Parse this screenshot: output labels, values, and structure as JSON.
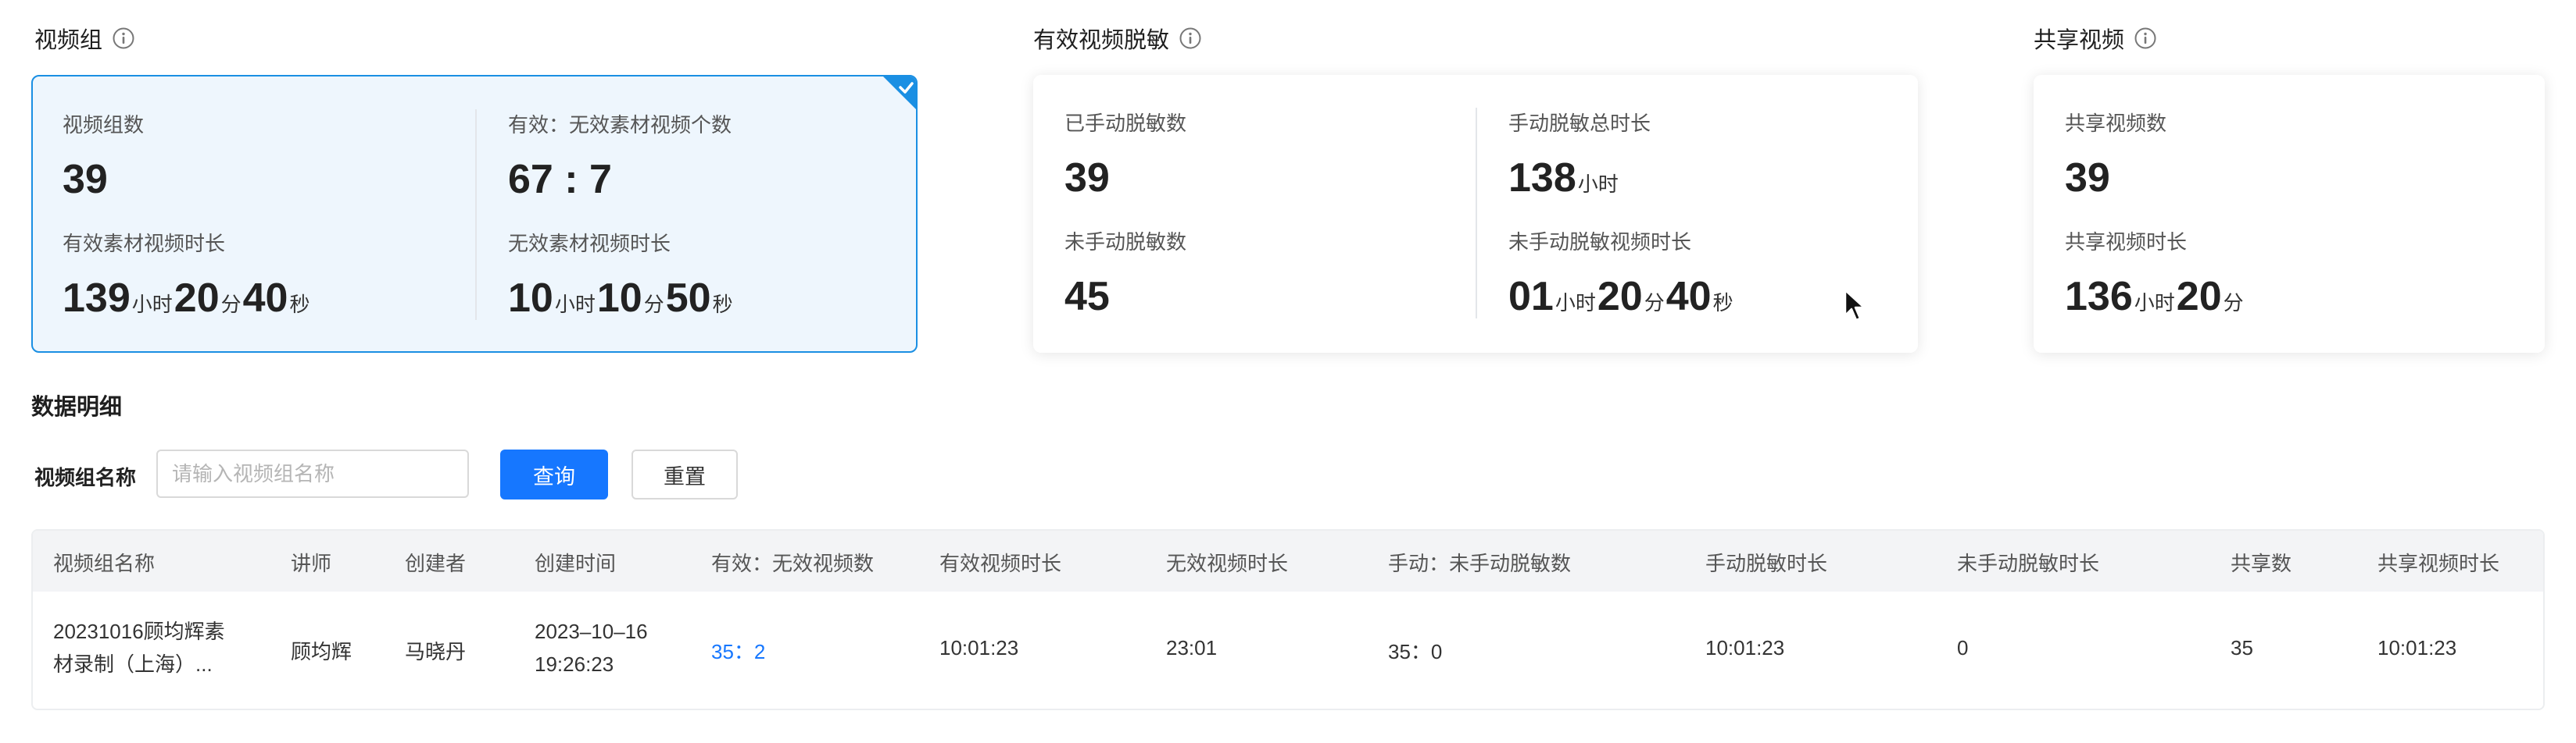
{
  "sections": {
    "video_group": {
      "title": "视频组",
      "metrics": {
        "group_count_label": "视频组数",
        "group_count_value": "39",
        "ratio_label": "有效：无效素材视频个数",
        "ratio_value": "67 : 7",
        "valid_duration_label": "有效素材视频时长",
        "valid_h": "139",
        "valid_m": "20",
        "valid_s": "40",
        "invalid_duration_label": "无效素材视频时长",
        "invalid_h": "10",
        "invalid_m": "10",
        "invalid_s": "50"
      }
    },
    "desensitize": {
      "title": "有效视频脱敏",
      "metrics": {
        "manual_count_label": "已手动脱敏数",
        "manual_count_value": "39",
        "manual_total_label": "手动脱敏总时长",
        "manual_total_value": "138",
        "unmanual_count_label": "未手动脱敏数",
        "unmanual_count_value": "45",
        "unmanual_duration_label": "未手动脱敏视频时长",
        "un_h": "01",
        "un_m": "20",
        "un_s": "40"
      }
    },
    "share": {
      "title": "共享视频",
      "metrics": {
        "share_count_label": "共享视频数",
        "share_count_value": "39",
        "share_duration_label": "共享视频时长",
        "share_h": "136",
        "share_m": "20"
      }
    }
  },
  "units": {
    "hour": "小时",
    "minute": "分",
    "second": "秒"
  },
  "detail": {
    "title": "数据明细",
    "filter_label": "视频组名称",
    "search_placeholder": "请输入视频组名称",
    "query_button": "查询",
    "reset_button": "重置"
  },
  "table": {
    "headers": [
      "视频组名称",
      "讲师",
      "创建者",
      "创建时间",
      "有效：无效视频数",
      "有效视频时长",
      "无效视频时长",
      "手动：未手动脱敏数",
      "手动脱敏时长",
      "未手动脱敏时长",
      "共享数",
      "共享视频时长"
    ],
    "rows": [
      {
        "name_line1": "20231016顾均辉素",
        "name_line2": "材录制（上海）...",
        "teacher": "顾均辉",
        "creator": "马晓丹",
        "date": "2023–10–16",
        "time": "19:26:23",
        "valid_invalid": "35：2",
        "valid_duration": "10:01:23",
        "invalid_duration": "23:01",
        "manual_ratio": "35：0",
        "manual_duration": "10:01:23",
        "unmanual_duration": "0",
        "share_count": "35",
        "share_duration": "10:01:23"
      }
    ]
  },
  "colors": {
    "primary": "#1677ff",
    "selected_border": "#1a8fe3",
    "selected_bg": "#eef6fd"
  },
  "icons": {
    "info": "info-circle-icon",
    "check": "check-corner-icon",
    "cursor": "mouse-cursor-icon"
  }
}
